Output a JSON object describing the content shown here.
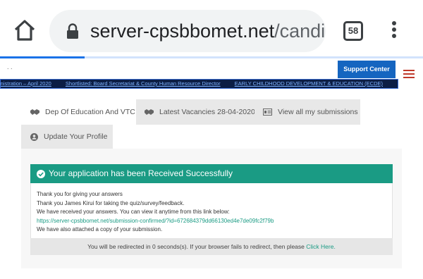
{
  "browser": {
    "url_host": "server-cpsbbomet.net",
    "url_path": "/candida",
    "tab_count": "58",
    "load_progress": 0.2
  },
  "header": {
    "dots": ". .",
    "support_label": "Support Center"
  },
  "ticker": {
    "items": [
      "inistration – April 2020",
      "Shortlisted: Board Secretariat & County Human Resource Director",
      "EARLY CHILDHOOD DEVELOPMENT & EDUCATION (ECDE)"
    ]
  },
  "tabs": [
    {
      "label": "Dep Of Education And VTC",
      "icon": "handshake-icon"
    },
    {
      "label": "Latest Vacancies 28-04-2020",
      "icon": "handshake-icon"
    },
    {
      "label": "View all my submissions",
      "icon": "id-card-icon"
    },
    {
      "label": "Update Your Profile",
      "icon": "user-circle-icon"
    }
  ],
  "alert": {
    "title": "Your application has been Received Successfully"
  },
  "message": {
    "line1": "Thank you for giving your answers",
    "line2": "Thank you James Kirui for taking the quiz/survey/feedback.",
    "line3": "We have received your answers. You can view it anytime from this link below:",
    "link": "https://server-cpsbbomet.net/submission-confirmed/?id=672684379dd66130ed4e7de09fc2f79b",
    "line4": "We have also attached a copy of your submission."
  },
  "redirect": {
    "text": "You will be redirected in 0 seconds(s). If your browser fails to redirect, then please",
    "link_label": "Click Here."
  },
  "colors": {
    "accent": "#1a9b84",
    "support": "#1565c0",
    "ticker_bg": "#0c1e45"
  }
}
